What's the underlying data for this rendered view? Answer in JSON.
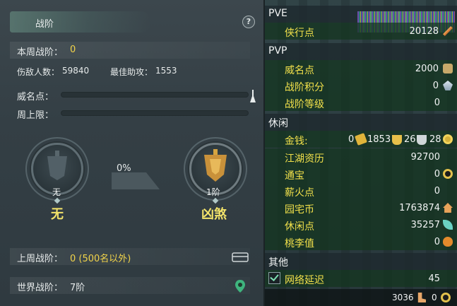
{
  "left_panel": {
    "title": "战阶",
    "help": "?",
    "weekly_rank": {
      "label": "本周战阶：",
      "value": "0"
    },
    "kills": {
      "label": "伤敌人数：",
      "value": "59840"
    },
    "best_assist": {
      "label": "最佳助攻：",
      "value": "1553"
    },
    "prestige": {
      "label": "威名点：",
      "progress": 0
    },
    "weekly_cap": {
      "label": "周上限：",
      "progress": 0
    },
    "current_rank": {
      "level": "无",
      "name": "无"
    },
    "next_rank": {
      "level": "1阶",
      "name": "凶煞"
    },
    "progress_percent": "0%",
    "last_week_rank": {
      "label": "上周战阶：",
      "value": "0 (500名以外)"
    },
    "world_rank": {
      "label": "世界战阶：",
      "value": "7阶"
    }
  },
  "right_panel": {
    "sections": {
      "pve": "PVE",
      "pvp": "PVP",
      "leisure": "休闲",
      "other": "其他"
    },
    "pve": [
      {
        "label": "侠行点",
        "value": "20128",
        "icon": "quill-icon"
      }
    ],
    "pvp": [
      {
        "label": "威名点",
        "value": "2000",
        "icon": "medal-icon"
      },
      {
        "label": "战阶积分",
        "value": "0",
        "icon": "crystal-icon"
      },
      {
        "label": "战阶等级",
        "value": "0"
      }
    ],
    "money": {
      "label": "金钱:",
      "gold_bar": "0",
      "gold": "1853",
      "silver": "26",
      "copper": "28"
    },
    "leisure": [
      {
        "label": "江湖资历",
        "value": "92700"
      },
      {
        "label": "通宝",
        "value": "0",
        "icon": "coin-icon"
      },
      {
        "label": "薪火点",
        "value": "0"
      },
      {
        "label": "园宅币",
        "value": "1763874",
        "icon": "house-icon"
      },
      {
        "label": "休闲点",
        "value": "35257",
        "icon": "leaf-icon"
      },
      {
        "label": "桃李值",
        "value": "0",
        "icon": "gourd-icon"
      }
    ],
    "network": {
      "label": "网络延迟",
      "value": "45"
    },
    "footer": {
      "value1": "3036",
      "value2": "0"
    }
  }
}
